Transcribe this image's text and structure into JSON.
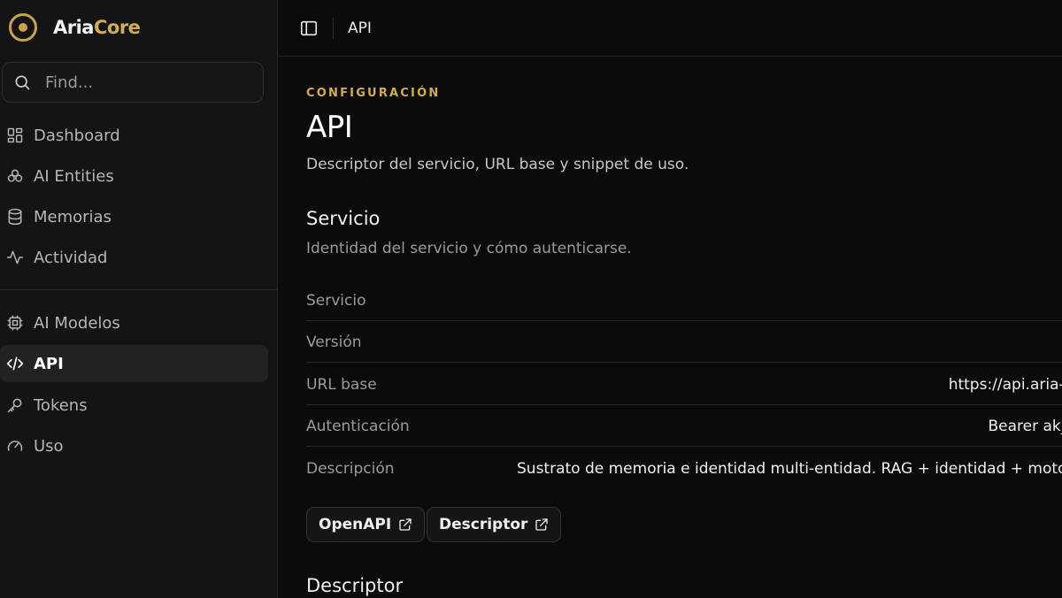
{
  "brand": {
    "name_part1": "Aria",
    "name_part2": "Core"
  },
  "search": {
    "placeholder": "Find..."
  },
  "sidebar": {
    "primary": [
      {
        "label": "Dashboard",
        "icon": "dashboard-icon"
      },
      {
        "label": "AI Entities",
        "icon": "entities-icon"
      },
      {
        "label": "Memorias",
        "icon": "database-icon"
      },
      {
        "label": "Actividad",
        "icon": "activity-icon"
      }
    ],
    "secondary": [
      {
        "label": "AI Modelos",
        "icon": "chip-icon"
      },
      {
        "label": "API",
        "icon": "code-icon",
        "active": true
      },
      {
        "label": "Tokens",
        "icon": "key-icon"
      },
      {
        "label": "Uso",
        "icon": "gauge-icon"
      }
    ]
  },
  "topbar": {
    "title": "API"
  },
  "page": {
    "eyebrow": "CONFIGURACIÓN",
    "title": "API",
    "subtitle": "Descriptor del servicio, URL base y snippet de uso."
  },
  "servicio": {
    "title": "Servicio",
    "subtitle": "Identidad del servicio y cómo autenticarse.",
    "rows": [
      {
        "key": "Servicio",
        "value": ""
      },
      {
        "key": "Versión",
        "value": ""
      },
      {
        "key": "URL base",
        "value": "https://api.aria-c"
      },
      {
        "key": "Autenticación",
        "value": "Bearer ak_l"
      },
      {
        "key": "Descripción",
        "value": "Sustrato de memoria e identidad multi-entidad. RAG + identidad + moto"
      }
    ],
    "buttons": {
      "openapi": "OpenAPI",
      "descriptor": "Descriptor"
    }
  },
  "descriptor": {
    "title": "Descriptor"
  },
  "colors": {
    "accent": "#d4ac55",
    "background": "#0b0b0c",
    "sidebar": "#141416"
  }
}
